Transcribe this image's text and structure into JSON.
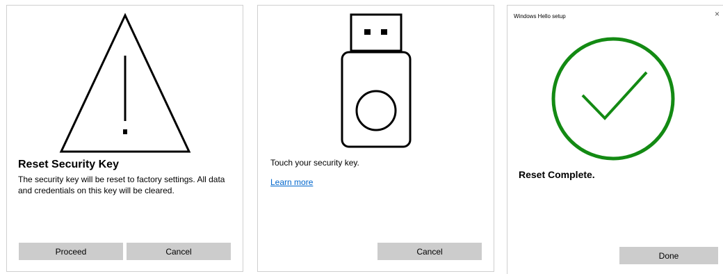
{
  "reset_dialog": {
    "heading": "Reset Security Key",
    "description": "The security key will be reset to factory settings. All data and credentials on this key will be cleared.",
    "proceed_label": "Proceed",
    "cancel_label": "Cancel",
    "icon": "warning-icon"
  },
  "touch_dialog": {
    "instruction": "Touch your security key.",
    "learn_more": "Learn more",
    "cancel_label": "Cancel",
    "icon": "usb-security-key-icon",
    "link_color": "#0066cc"
  },
  "complete_dialog": {
    "window_title": "Windows Hello setup",
    "close_label": "×",
    "message": "Reset Complete.",
    "done_label": "Done",
    "icon": "checkmark-circle-icon",
    "success_color": "#138a13"
  }
}
